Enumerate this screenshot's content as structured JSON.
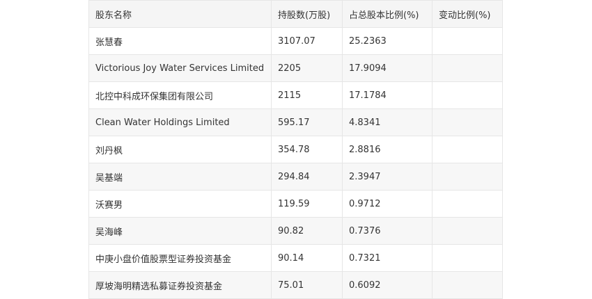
{
  "table": {
    "headers": [
      "股东名称",
      "持股数(万股)",
      "占总股本比例(%)",
      "变动比例(%)"
    ],
    "rows": [
      [
        "张慧春",
        "3107.07",
        "25.2363",
        ""
      ],
      [
        "Victorious Joy Water Services Limited",
        "2205",
        "17.9094",
        ""
      ],
      [
        "北控中科成环保集团有限公司",
        "2115",
        "17.1784",
        ""
      ],
      [
        "Clean Water Holdings Limited",
        "595.17",
        "4.8341",
        ""
      ],
      [
        "刘丹枫",
        "354.78",
        "2.8816",
        ""
      ],
      [
        "吴基端",
        "294.84",
        "2.3947",
        ""
      ],
      [
        "沃赛男",
        "119.59",
        "0.9712",
        ""
      ],
      [
        "吴海峰",
        "90.82",
        "0.7376",
        ""
      ],
      [
        "中庚小盘价值股票型证券投资基金",
        "90.14",
        "0.7321",
        ""
      ],
      [
        "厚坡海明精选私募证券投资基金",
        "75.01",
        "0.6092",
        ""
      ]
    ]
  }
}
